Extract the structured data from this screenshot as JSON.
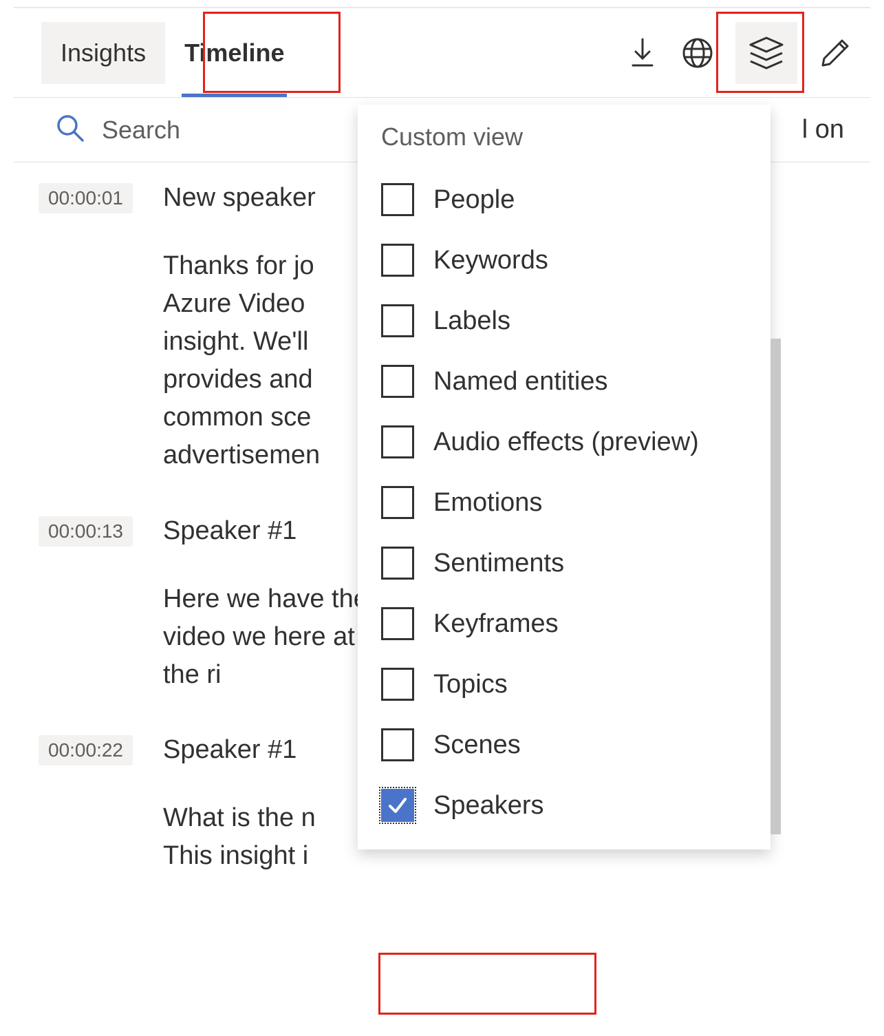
{
  "tabs": {
    "insights": "Insights",
    "timeline": "Timeline"
  },
  "search": {
    "placeholder": "Search"
  },
  "behind_text": "l on",
  "entries": [
    {
      "timestamp": "00:00:01",
      "speaker": "New speaker",
      "text": "Thanks for jo Azure Video insight. We'll provides and common sce advertisemen"
    },
    {
      "timestamp": "00:00:13",
      "speaker": "Speaker #1",
      "text": "Here we have the video we here at the ri"
    },
    {
      "timestamp": "00:00:22",
      "speaker": "Speaker #1",
      "text": "What is the n This insight i"
    }
  ],
  "dropdown": {
    "title": "Custom view",
    "items": [
      {
        "label": "People",
        "checked": false
      },
      {
        "label": "Keywords",
        "checked": false
      },
      {
        "label": "Labels",
        "checked": false
      },
      {
        "label": "Named entities",
        "checked": false
      },
      {
        "label": "Audio effects (preview)",
        "checked": false
      },
      {
        "label": "Emotions",
        "checked": false
      },
      {
        "label": "Sentiments",
        "checked": false
      },
      {
        "label": "Keyframes",
        "checked": false
      },
      {
        "label": "Topics",
        "checked": false
      },
      {
        "label": "Scenes",
        "checked": false
      },
      {
        "label": "Speakers",
        "checked": true
      }
    ]
  }
}
